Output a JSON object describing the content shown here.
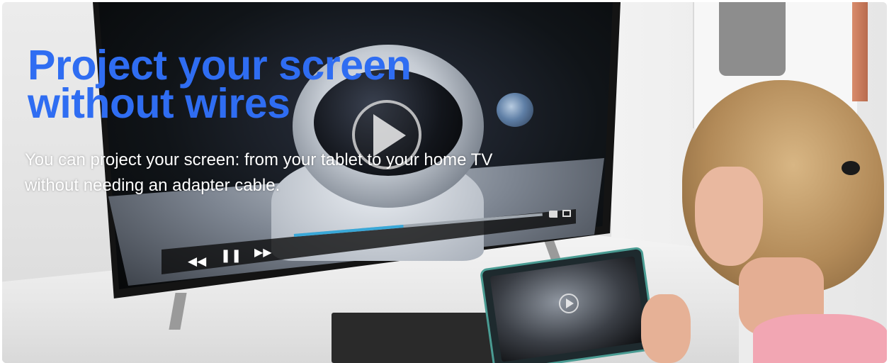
{
  "banner": {
    "headline": "Project your screen without wires",
    "subtext": "You can project your screen: from your tablet to your home TV without needing an adapter cable."
  },
  "player": {
    "progress": 0.44,
    "controls": [
      "rewind-icon",
      "pause-icon",
      "fast-forward-icon",
      "volume-icon",
      "fullscreen-icon"
    ],
    "glyphs": {
      "rewind": "◀◀",
      "pause": "❚❚",
      "forward": "▶▶"
    },
    "progress_color": "#39a8d8"
  },
  "theme": {
    "headline_color": "#2f6df2",
    "subtext_color": "#ffffff"
  }
}
